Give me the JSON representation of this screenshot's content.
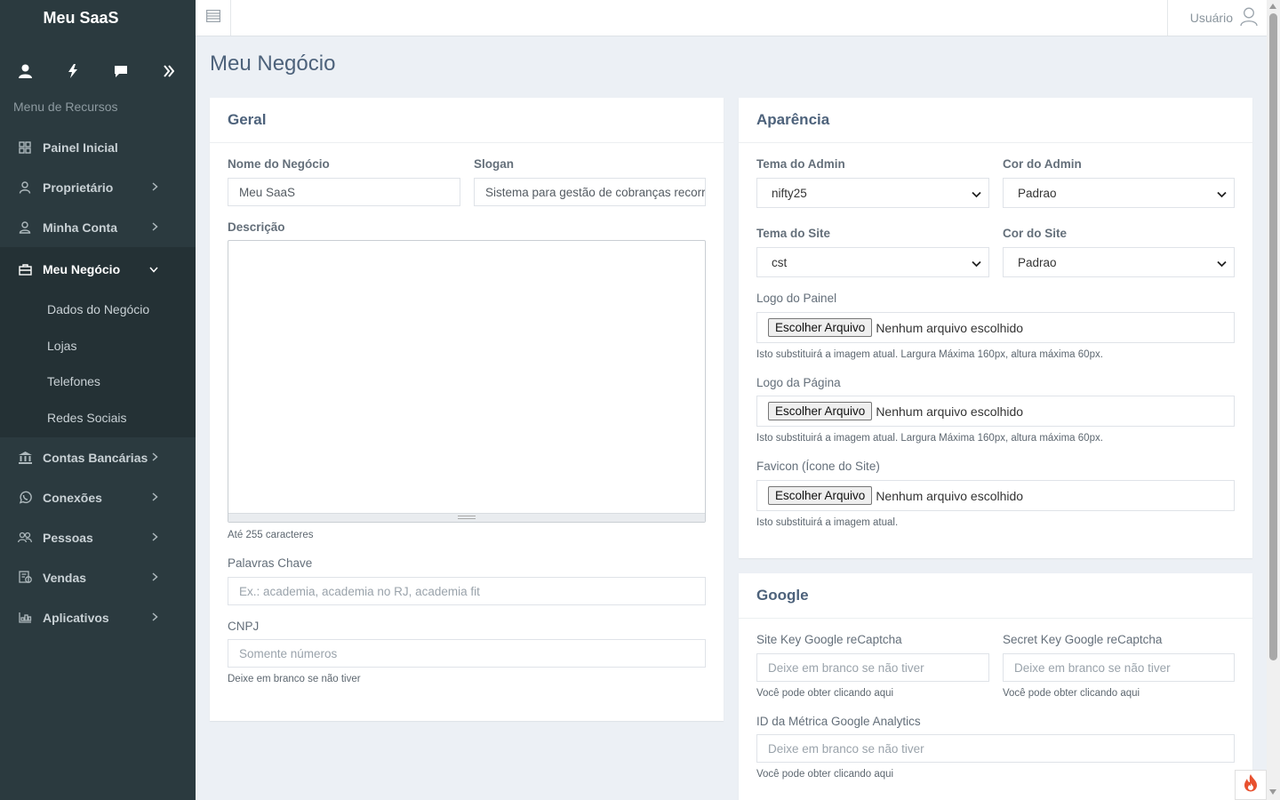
{
  "sidebar": {
    "brand": "Meu SaaS",
    "menu_title": "Menu de Recursos",
    "items": [
      {
        "label": "Painel Inicial"
      },
      {
        "label": "Proprietário"
      },
      {
        "label": "Minha Conta"
      },
      {
        "label": "Meu Negócio"
      },
      {
        "label": "Contas Bancárias"
      },
      {
        "label": "Conexões"
      },
      {
        "label": "Pessoas"
      },
      {
        "label": "Vendas"
      },
      {
        "label": "Aplicativos"
      }
    ],
    "submenu": [
      {
        "label": "Dados do Negócio"
      },
      {
        "label": "Lojas"
      },
      {
        "label": "Telefones"
      },
      {
        "label": "Redes Sociais"
      }
    ]
  },
  "topbar": {
    "user_label": "Usuário"
  },
  "page": {
    "title": "Meu Negócio"
  },
  "geral": {
    "title": "Geral",
    "nome_label": "Nome do Negócio",
    "nome_value": "Meu SaaS",
    "slogan_label": "Slogan",
    "slogan_value": "Sistema para gestão de cobranças recorrentes",
    "descricao_label": "Descrição",
    "descricao_help": "Até 255 caracteres",
    "palavras_label": "Palavras Chave",
    "palavras_placeholder": "Ex.: academia, academia no RJ, academia fit",
    "cnpj_label": "CNPJ",
    "cnpj_placeholder": "Somente números",
    "cnpj_help": "Deixe em branco se não tiver"
  },
  "aparencia": {
    "title": "Aparência",
    "tema_admin_label": "Tema do Admin",
    "tema_admin_value": "nifty25",
    "cor_admin_label": "Cor do Admin",
    "cor_admin_value": "Padrao",
    "tema_site_label": "Tema do Site",
    "tema_site_value": "cst",
    "cor_site_label": "Cor do Site",
    "cor_site_value": "Padrao",
    "file_button": "Escolher Arquivo",
    "file_none": "Nenhum arquivo escolhido",
    "logo_painel_label": "Logo do Painel",
    "logo_painel_help": "Isto substituirá a imagem atual. Largura Máxima 160px, altura máxima 60px.",
    "logo_pagina_label": "Logo da Página",
    "logo_pagina_help": "Isto substituirá a imagem atual. Largura Máxima 160px, altura máxima 60px.",
    "favicon_label": "Favicon (Ícone do Site)",
    "favicon_help": "Isto substituirá a imagem atual."
  },
  "google": {
    "title": "Google",
    "site_key_label": "Site Key Google reCaptcha",
    "secret_key_label": "Secret Key Google reCaptcha",
    "placeholder": "Deixe em branco se não tiver",
    "help": "Você pode obter clicando aqui",
    "analytics_label": "ID da Métrica Google Analytics"
  },
  "colors": {
    "sidebar_bg": "#2b3a3f",
    "sidebar_active": "#243135",
    "content_bg": "#ecf0f5",
    "heading": "#4d627b",
    "fire": "#e8512f"
  },
  "icons": {
    "sidebar_tools": [
      "user-icon",
      "bolt-icon",
      "chat-icon",
      "double-chevron-right-icon"
    ],
    "nav": [
      "grid-icon",
      "user-tie-icon",
      "user-icon",
      "briefcase-icon",
      "bank-icon",
      "whatsapp-icon",
      "users-icon",
      "receipt-icon",
      "apps-icon"
    ]
  }
}
